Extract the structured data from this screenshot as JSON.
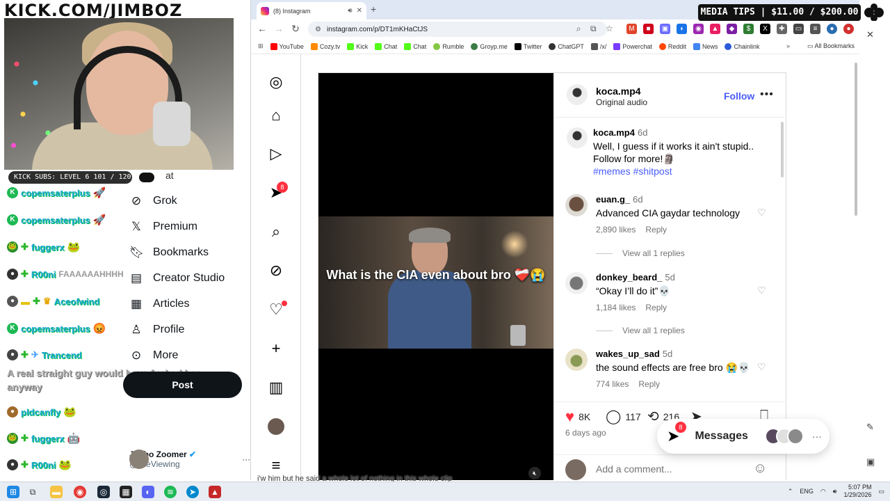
{
  "overlay": {
    "banner": "KICK.COM/JIMBOZ",
    "subs": "KICK SUBS: LEVEL 6 101 / 120",
    "tips": "MEDIA TIPS | $11.00 / $200.00"
  },
  "stream_chat": [
    {
      "user": "copemsaterplus",
      "msg": "",
      "badge_color": "#1db954"
    },
    {
      "user": "copemsaterplus",
      "msg": "",
      "badge_color": "#1db954"
    },
    {
      "user": "fuggerx",
      "msg": "",
      "badge_color": "#2d8f2d"
    },
    {
      "user": "R00ni",
      "msg": "FAAAAAAHHHH",
      "badge_color": "#333333"
    },
    {
      "user": "Aceofwind",
      "msg": "",
      "badge_color": "#555555"
    },
    {
      "user": "copemsaterplus",
      "msg": "",
      "badge_color": "#1db954"
    },
    {
      "user": "Trancend",
      "msg": "",
      "badge_color": "#444444"
    },
    {
      "user": "pldcanfly",
      "msg": "",
      "badge_color": "#a06a2c"
    },
    {
      "user": "fuggerx",
      "msg": "",
      "badge_color": "#2d8f2d"
    },
    {
      "user": "R00ni",
      "msg": "",
      "badge_color": "#333333"
    }
  ],
  "stream_chat_long": "A real straight guy would have fucked her anyway",
  "x_sidebar": {
    "partial_top": "at",
    "items": [
      "Grok",
      "Premium",
      "Bookmarks",
      "Creator Studio",
      "Articles",
      "Profile",
      "More"
    ],
    "post_button": "Post",
    "user_name": "Jimbo Zoomer",
    "user_handle": "@JzeViewing"
  },
  "browser": {
    "tab_title": "(8) Instagram",
    "url": "instagram.com/p/DT1mKHaCtJS",
    "bookmarks": [
      {
        "label": "YouTube",
        "color": "#ff0000"
      },
      {
        "label": "Cozy.tv",
        "color": "#ff8a00"
      },
      {
        "label": "Kick",
        "color": "#53fc18"
      },
      {
        "label": "Chat",
        "color": "#53fc18"
      },
      {
        "label": "Chat",
        "color": "#53fc18"
      },
      {
        "label": "Rumble",
        "color": "#85c742"
      },
      {
        "label": "Groyp.me",
        "color": "#3a7d44"
      },
      {
        "label": "Twitter",
        "color": "#000000"
      },
      {
        "label": "ChatGPT",
        "color": "#333333"
      },
      {
        "label": "/x/",
        "color": "#555555"
      },
      {
        "label": "Powerchat",
        "color": "#7a3cff"
      },
      {
        "label": "Reddit",
        "color": "#ff4500"
      },
      {
        "label": "News",
        "color": "#4285f4"
      },
      {
        "label": "Chainlink",
        "color": "#2a5ada"
      }
    ],
    "all_bookmarks": "All Bookmarks",
    "partial_left": "Groyp",
    "partial_right": "ookmarks"
  },
  "instagram": {
    "notification_count": "8",
    "post": {
      "username": "koca.mp4",
      "audio": "Original audio",
      "follow": "Follow",
      "caption_user": "koca.mp4",
      "caption_time": "6d",
      "caption_text": "Well, I guess if it works it ain't stupid.. Follow for more!🗿",
      "caption_tags": "#memes #shitpost",
      "video_caption": "What is the CIA even about bro ❤️‍🩹😭"
    },
    "comments": [
      {
        "user": "euan.g_",
        "time": "6d",
        "text": "Advanced CIA gaydar technology",
        "likes": "2,890 likes",
        "reply": "Reply",
        "replies": "View all 1 replies"
      },
      {
        "user": "donkey_beard_",
        "time": "5d",
        "text": "“Okay I’ll do it”💀",
        "likes": "1,184 likes",
        "reply": "Reply",
        "replies": "View all 1 replies"
      },
      {
        "user": "wakes_up_sad",
        "time": "5d",
        "text": "the sound effects are free bro 😭💀",
        "likes": "774 likes",
        "reply": "Reply"
      }
    ],
    "likes": "8K",
    "comment_count": "117",
    "repost_count": "216",
    "date": "6 days ago",
    "add_comment": "Add a comment...",
    "messages": "Messages",
    "messages_badge": "8"
  },
  "bottom_chat": "i'w him but he said a whole lot of nothing in this whole clip",
  "taskbar": {
    "lang": "ENG",
    "time": "5:07 PM",
    "date": "1/29/2026"
  }
}
